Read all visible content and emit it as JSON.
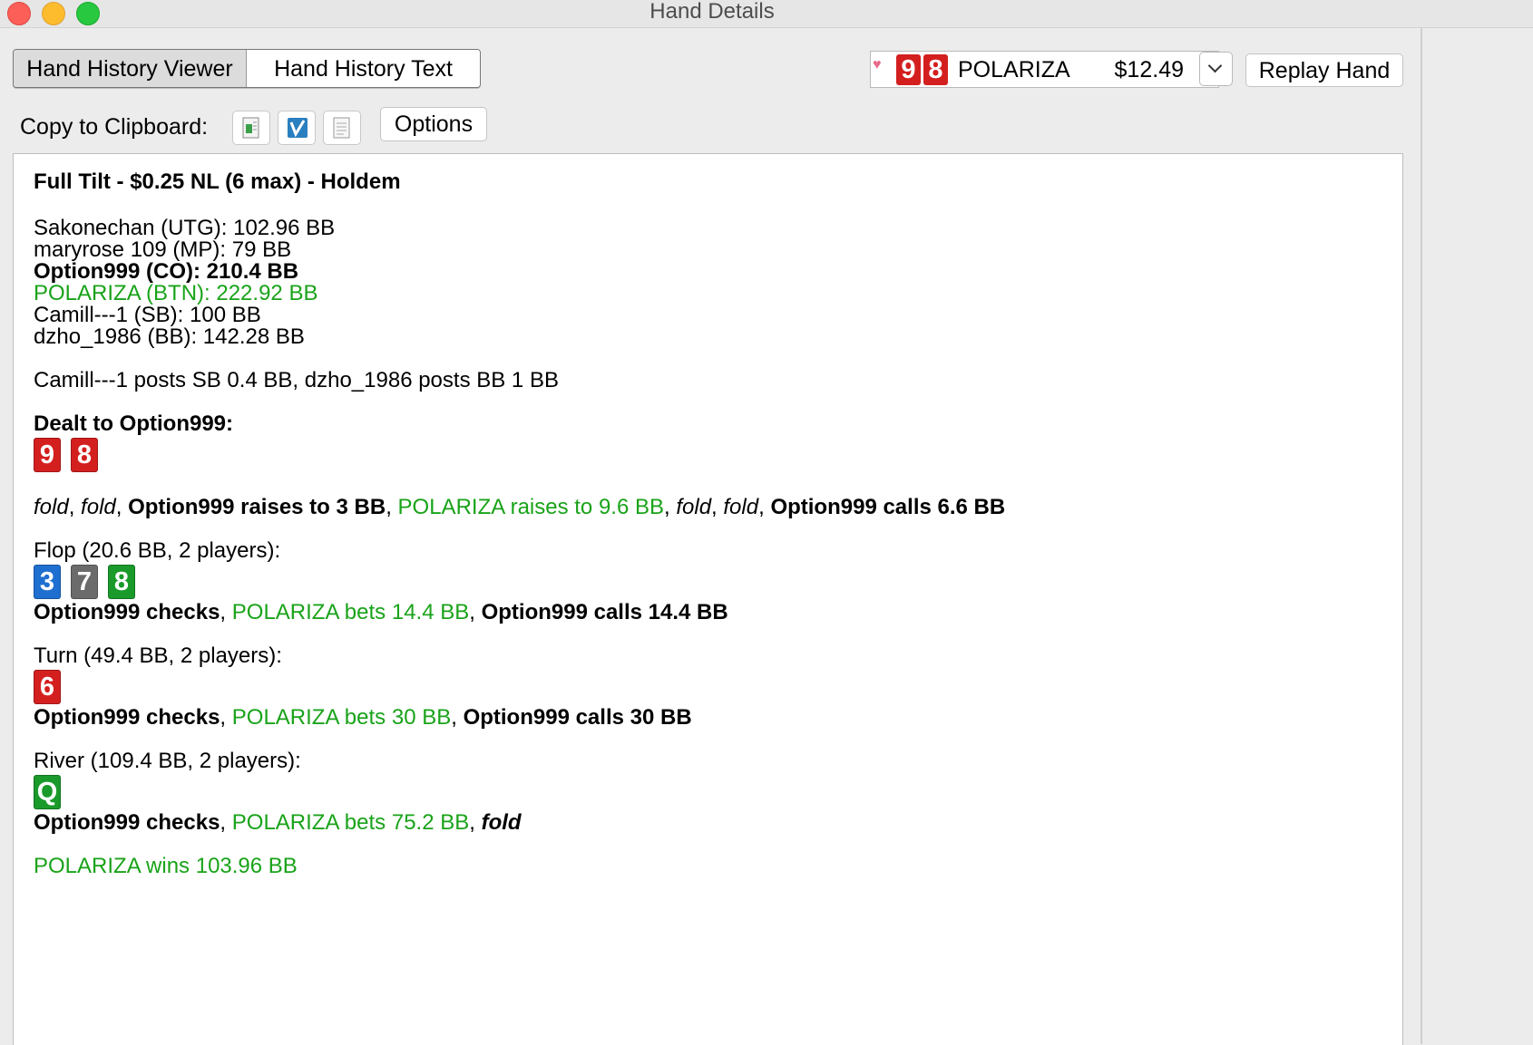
{
  "window": {
    "title": "Hand Details"
  },
  "tabs": [
    {
      "label": "Hand History Viewer",
      "active": true
    },
    {
      "label": "Hand History Text",
      "active": false
    }
  ],
  "hero": {
    "cards": [
      "9",
      "8"
    ],
    "card_color": "#d41f1f",
    "name": "POLARIZA",
    "amount": "$12.49"
  },
  "replay_label": "Replay Hand",
  "clipboard": {
    "label": "Copy to Clipboard:",
    "icons": [
      "spreadsheet-icon",
      "forum-icon",
      "text-document-icon"
    ]
  },
  "options_label": "Options",
  "hand": {
    "header": "Full Tilt - $0.25 NL (6 max) - Holdem",
    "players": [
      {
        "text": "Sakonechan (UTG): 102.96 BB",
        "style": "normal"
      },
      {
        "text": "maryrose 109 (MP): 79 BB",
        "style": "normal"
      },
      {
        "text": "Option999 (CO): 210.4 BB",
        "style": "bold"
      },
      {
        "text": "POLARIZA (BTN): 222.92 BB",
        "style": "hero"
      },
      {
        "text": "Camill---1 (SB): 100 BB",
        "style": "normal"
      },
      {
        "text": "dzho_1986 (BB): 142.28 BB",
        "style": "normal"
      }
    ],
    "blinds": "Camill---1 posts SB 0.4 BB, dzho_1986 posts BB 1 BB",
    "dealt_label": "Dealt to Option999:",
    "dealt_cards": [
      {
        "rank": "9",
        "color": "#d41f1f"
      },
      {
        "rank": "8",
        "color": "#d41f1f"
      }
    ],
    "preflop": {
      "a1": "fold",
      "a2": "fold",
      "a3": "Option999 raises to 3 BB",
      "a4": "POLARIZA raises to 9.6 BB",
      "a5": "fold",
      "a6": "fold",
      "a7": "Option999 calls 6.6 BB",
      "sep": ", "
    },
    "flop": {
      "label": "Flop (20.6 BB, 2 players):",
      "cards": [
        {
          "rank": "3",
          "color": "#1f6fd0"
        },
        {
          "rank": "7",
          "color": "#6b6b6b"
        },
        {
          "rank": "8",
          "color": "#1a9a2a"
        }
      ],
      "a1": "Option999 checks",
      "a2": "POLARIZA bets 14.4 BB",
      "a3": "Option999 calls 14.4 BB"
    },
    "turn": {
      "label": "Turn (49.4 BB, 2 players):",
      "cards": [
        {
          "rank": "6",
          "color": "#d41f1f"
        }
      ],
      "a1": "Option999 checks",
      "a2": "POLARIZA bets 30 BB",
      "a3": "Option999 calls 30 BB"
    },
    "river": {
      "label": "River (109.4 BB, 2 players):",
      "cards": [
        {
          "rank": "Q",
          "color": "#1a9a2a"
        }
      ],
      "a1": "Option999 checks",
      "a2": "POLARIZA bets 75.2 BB",
      "a3": "fold"
    },
    "result": "POLARIZA wins 103.96 BB"
  }
}
